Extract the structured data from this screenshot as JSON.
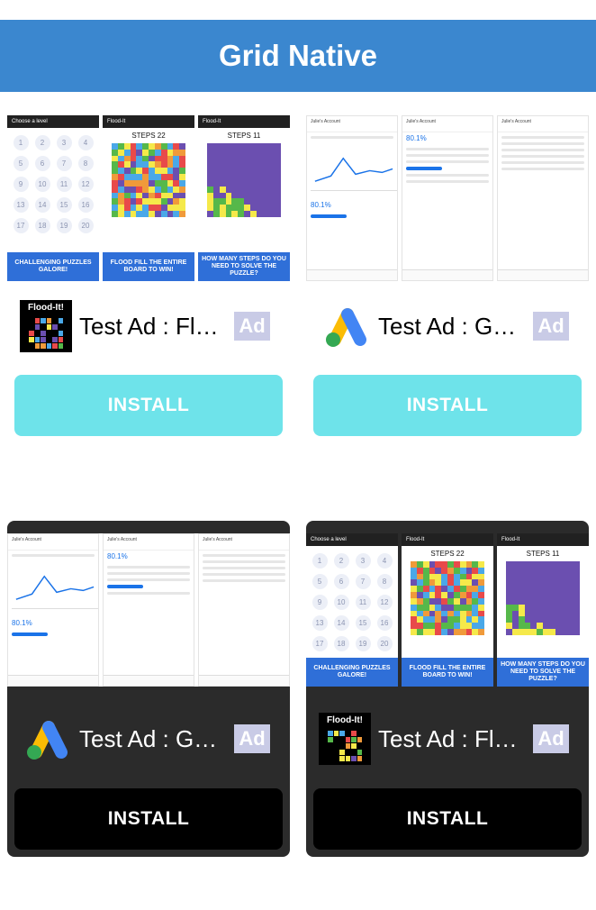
{
  "appbar": {
    "title": "Grid Native"
  },
  "ad_badge_label": "Ad",
  "cards": [
    {
      "title": "Test Ad : Fl…",
      "install": "INSTALL",
      "shot": {
        "choose_level": "Choose a level",
        "flood_it": "Flood-It",
        "steps_a": "STEPS 22",
        "steps_b": "STEPS 11",
        "caption1": "CHALLENGING PUZZLES GALORE!",
        "caption2": "FLOOD FILL THE ENTIRE BOARD TO WIN!",
        "caption3": "HOW MANY STEPS DO YOU NEED TO SOLVE THE PUZZLE?",
        "levels": [
          "1",
          "2",
          "3",
          "4",
          "5",
          "6",
          "7",
          "8",
          "9",
          "10",
          "11",
          "12",
          "13",
          "14",
          "15",
          "16",
          "17",
          "18",
          "19",
          "20"
        ]
      },
      "icon": {
        "text": "Flood-It!"
      }
    },
    {
      "title": "Test Ad : Go…",
      "install": "INSTALL",
      "shot": {
        "account": "Julie's Account",
        "pct": "80.1%"
      }
    },
    {
      "title": "Test Ad : Go…",
      "install": "INSTALL",
      "shot": {
        "account": "Julie's Account",
        "pct": "80.1%"
      }
    },
    {
      "title": "Test Ad : Fl…",
      "install": "INSTALL",
      "shot": {
        "choose_level": "Choose a level",
        "flood_it": "Flood-It",
        "steps_a": "STEPS 22",
        "steps_b": "STEPS 11",
        "caption1": "CHALLENGING PUZZLES GALORE!",
        "caption2": "FLOOD FILL THE ENTIRE BOARD TO WIN!",
        "caption3": "HOW MANY STEPS DO YOU NEED TO SOLVE THE PUZZLE?",
        "levels": [
          "1",
          "2",
          "3",
          "4",
          "5",
          "6",
          "7",
          "8",
          "9",
          "10",
          "11",
          "12",
          "13",
          "14",
          "15",
          "16",
          "17",
          "18",
          "19",
          "20"
        ]
      },
      "icon": {
        "text": "Flood-It!"
      }
    }
  ],
  "colors": {
    "appbar": "#3b87cf",
    "install_light": "#6ee3ea",
    "install_dark": "#000000",
    "dark_card": "#2b2b2b",
    "ad_badge": "#c9cbe6"
  }
}
